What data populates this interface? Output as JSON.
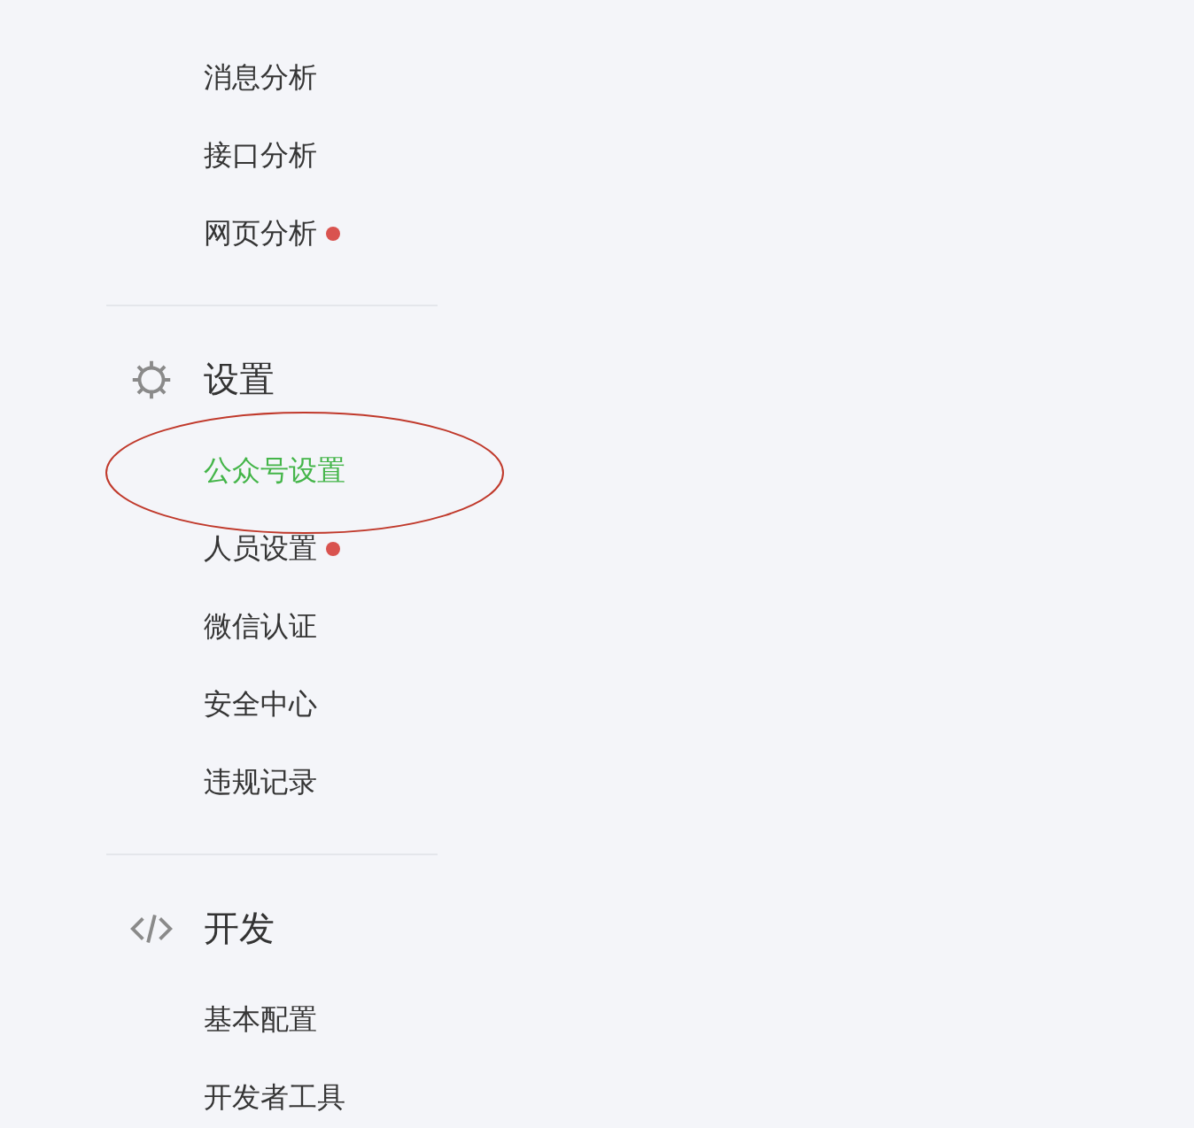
{
  "sections": [
    {
      "items": [
        {
          "label": "消息分析",
          "selected": false,
          "dot": false
        },
        {
          "label": "接口分析",
          "selected": false,
          "dot": false
        },
        {
          "label": "网页分析",
          "selected": false,
          "dot": true
        }
      ]
    },
    {
      "kind": "settings",
      "title": "设置",
      "items": [
        {
          "label": "公众号设置",
          "selected": true,
          "dot": false
        },
        {
          "label": "人员设置",
          "selected": false,
          "dot": true
        },
        {
          "label": "微信认证",
          "selected": false,
          "dot": false
        },
        {
          "label": "安全中心",
          "selected": false,
          "dot": false
        },
        {
          "label": "违规记录",
          "selected": false,
          "dot": false
        }
      ]
    },
    {
      "kind": "developer",
      "title": "开发",
      "items": [
        {
          "label": "基本配置",
          "selected": false,
          "dot": false
        },
        {
          "label": "开发者工具",
          "selected": false,
          "dot": false
        }
      ]
    }
  ]
}
